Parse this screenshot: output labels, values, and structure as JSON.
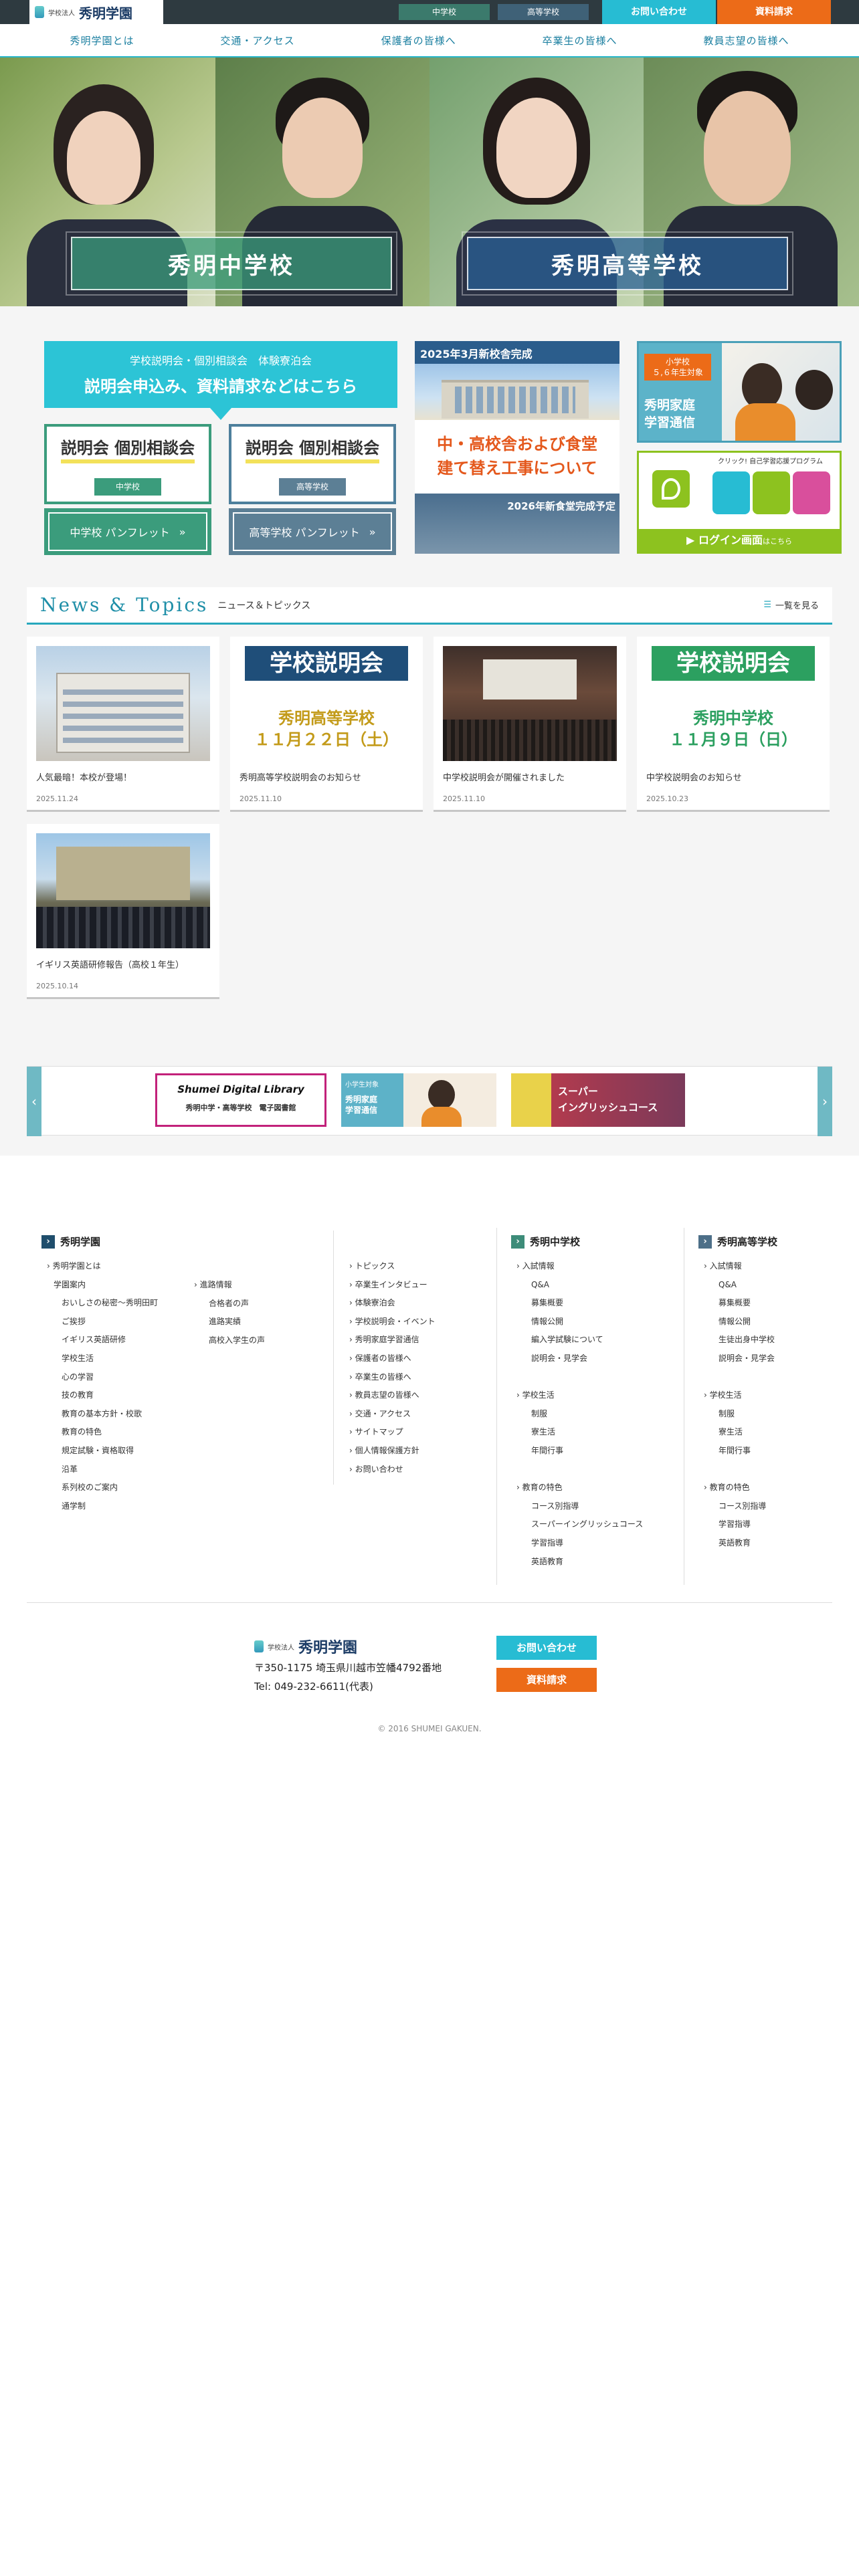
{
  "header": {
    "logo": {
      "corp": "学校法人",
      "name": "秀明学園"
    },
    "links": {
      "junior": "中学校",
      "high": "高等学校"
    },
    "contact": "お問い合わせ",
    "docs": "資料請求"
  },
  "nav": [
    "秀明学園とは",
    "交通・アクセス",
    "保護者の皆様へ",
    "卒業生の皆様へ",
    "教員志望の皆様へ"
  ],
  "hero": {
    "junior": "秀明中学校",
    "high": "秀明高等学校"
  },
  "banners": {
    "top_line1": "学校説明会・個別相談会　体験寮泊会",
    "top_line2": "説明会申込み、資料請求などはこちら",
    "session_title": "説明会 個別相談会",
    "session_junior_tag": "中学校",
    "session_high_tag": "高等学校",
    "pamphlet_junior": "中学校 パンフレット",
    "pamphlet_high": "高等学校 パンフレット",
    "building_header": "2025年3月新校舎完成",
    "building_line1": "中・高校舎および食堂",
    "building_line2": "建て替え工事について",
    "building_footer": "2026年新食堂完成予定",
    "family_tag": "小学校\n５,６年生対象",
    "family_title": "秀明家庭\n学習通信",
    "login_caption": "クリック! 自己学習応援プログラム",
    "login_btn": "ログイン画面",
    "login_btn_sub": "はこちら"
  },
  "news": {
    "title": "News & Topics",
    "subtitle": "ニュース＆トピックス",
    "more": "一覧を見る",
    "items": [
      {
        "title": "人気最暗！本校が登場！",
        "date": "2025.11.24"
      },
      {
        "title": "秀明高等学校説明会のお知らせ",
        "date": "2025.11.10",
        "ribbon": "学校説明会",
        "body1": "秀明高等学校",
        "body2": "１１月２２日（土）"
      },
      {
        "title": "中学校説明会が開催されました",
        "date": "2025.11.10"
      },
      {
        "title": "中学校説明会のお知らせ",
        "date": "2025.10.23",
        "ribbon": "学校説明会",
        "body1": "秀明中学校",
        "body2": "１１月９日（日）"
      },
      {
        "title": "イギリス英語研修報告（高校１年生）",
        "date": "2025.10.14"
      }
    ]
  },
  "strip": {
    "library_1": "Shumei Digital Library",
    "library_2": "秀明中学・高等学校　電子図書館",
    "family_tag": "小学生対象",
    "family_1": "秀明家庭",
    "family_2": "学習通信",
    "super_1": "スーパー",
    "super_2": "イングリッシュコース"
  },
  "footer": {
    "gakuen_head": "秀明学園",
    "gakuen_col1": [
      "秀明学園とは",
      "学園案内",
      "おいしさの秘密〜秀明田町",
      "ご挨拶",
      "イギリス英語研修",
      "学校生活",
      "心の学習",
      "技の教育",
      "教育の基本方針・校歌",
      "教育の特色",
      "規定試験・資格取得",
      "沿革",
      "系列校のご案内",
      "通学制"
    ],
    "gakuen_col2": [
      "進路情報",
      "合格者の声",
      "進路実績",
      "高校入学生の声"
    ],
    "tabs": [
      "トピックス",
      "卒業生インタビュー",
      "体験寮泊会",
      "学校説明会・イベント",
      "秀明家庭学習通信",
      "保護者の皆様へ",
      "卒業生の皆様へ",
      "教員志望の皆様へ",
      "交通・アクセス",
      "サイトマップ",
      "個人情報保護方針",
      "お問い合わせ"
    ],
    "junior_head": "秀明中学校",
    "junior_list": [
      "入試情報",
      "Q&A",
      "募集概要",
      "情報公開",
      "編入学試験について",
      "説明会・見学会",
      "",
      "学校生活",
      "制服",
      "寮生活",
      "年間行事",
      "",
      "教育の特色",
      "コース別指導",
      "スーパーイングリッシュコース",
      "学習指導",
      "英語教育"
    ],
    "high_head": "秀明高等学校",
    "high_list": [
      "入試情報",
      "Q&A",
      "募集概要",
      "情報公開",
      "生徒出身中学校",
      "説明会・見学会",
      "",
      "学校生活",
      "制服",
      "寮生活",
      "年間行事",
      "",
      "教育の特色",
      "コース別指導",
      "学習指導",
      "英語教育"
    ],
    "logo_corp": "学校法人",
    "logo_name": "秀明学園",
    "address": "〒350-1175 埼玉県川越市笠幡4792番地",
    "tel": "Tel: 049-232-6611(代表)",
    "contact": "お問い合わせ",
    "docs": "資料請求",
    "copyright": "© 2016 SHUMEI GAKUEN."
  },
  "colors": {
    "accent": "#27bcd3",
    "orange": "#ec6b18",
    "green": "#3b9c7c",
    "navy": "#1f4e6c"
  }
}
